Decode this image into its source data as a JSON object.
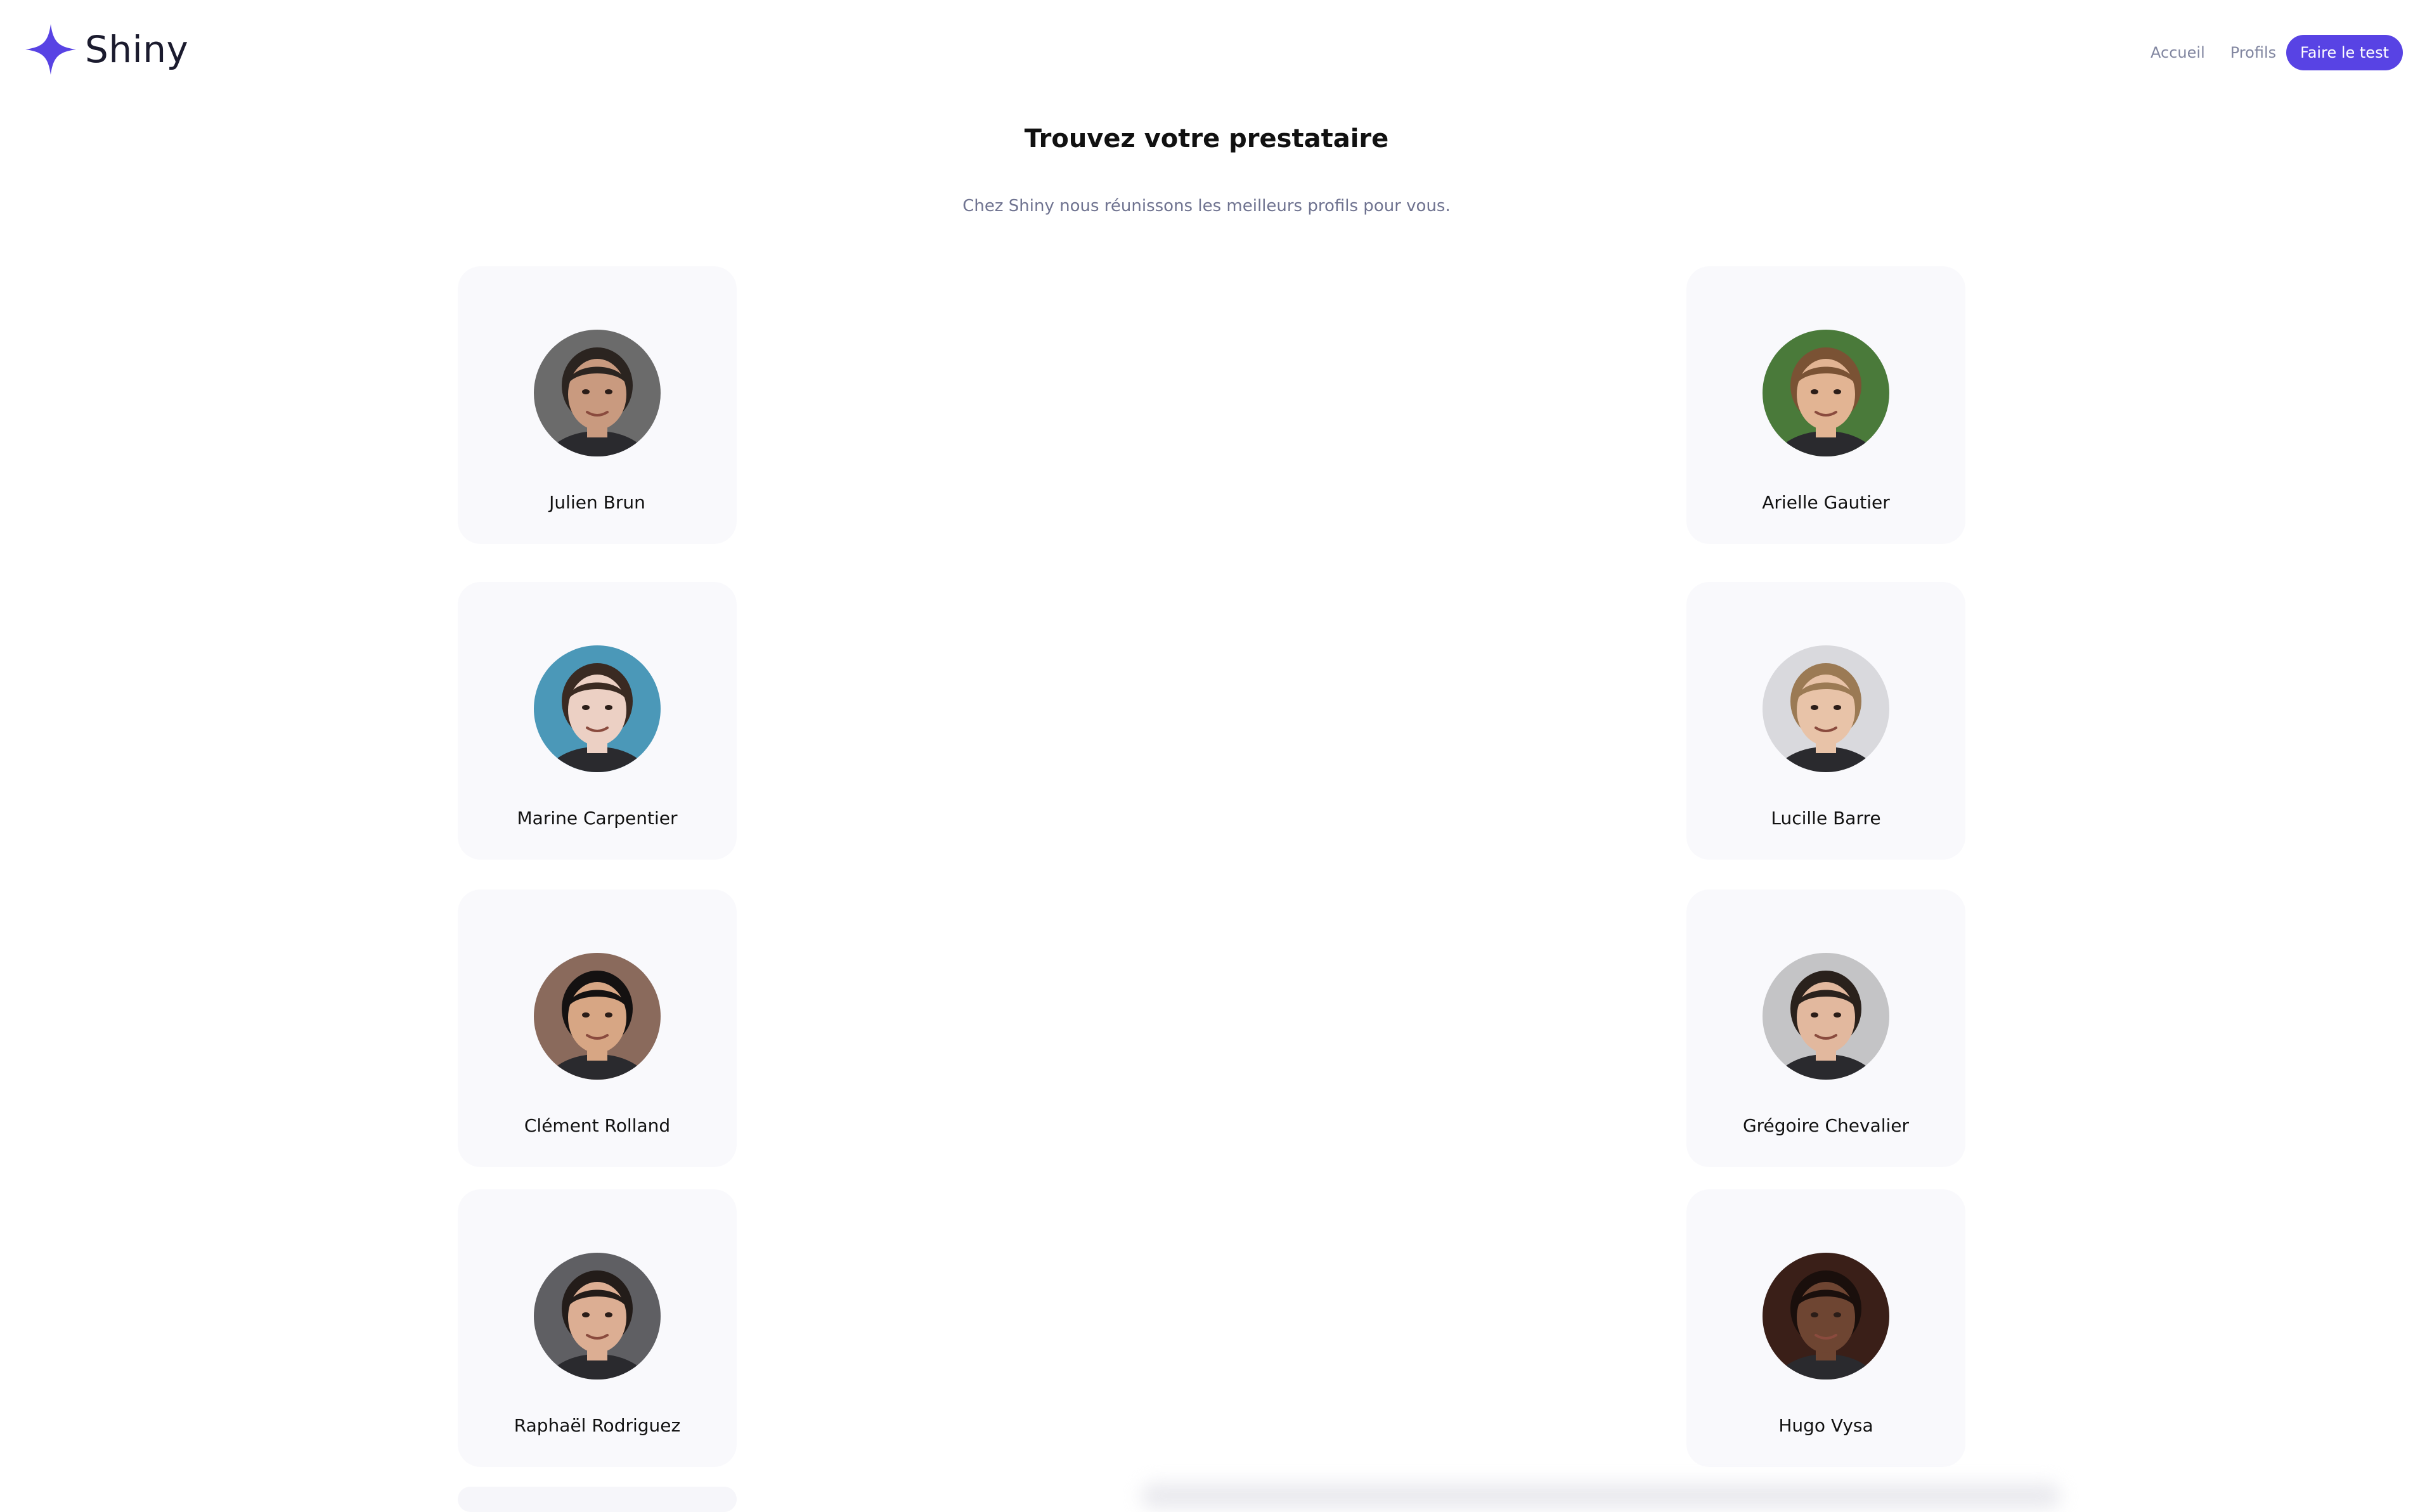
{
  "header": {
    "logo_text": "Shiny",
    "brand_color": "#5843e4",
    "nav": {
      "home_label": "Accueil",
      "profiles_label": "Profils",
      "test_label": "Faire le test"
    }
  },
  "main": {
    "title": "Trouvez votre prestataire",
    "subtitle": "Chez Shiny nous réunissons les meilleurs profils pour vous."
  },
  "profiles": [
    {
      "name": "Julien Brun",
      "avatar": "avatar-man-beard-gray-bg",
      "bg": "#6b6b6b",
      "skin": "#c99a7f",
      "hair": "#2b2420"
    },
    {
      "name": "Arielle Gautier",
      "avatar": "avatar-woman-green-bg",
      "bg": "#4a7a3a",
      "skin": "#e2b493",
      "hair": "#7a5234"
    },
    {
      "name": "Marine Carpentier",
      "avatar": "avatar-woman-blue-bg",
      "bg": "#4b98b8",
      "skin": "#ecd0c4",
      "hair": "#3a2a22"
    },
    {
      "name": "Lucille Barre",
      "avatar": "avatar-woman-light-bg",
      "bg": "#d9d9dd",
      "skin": "#e8c3a8",
      "hair": "#9b7a54"
    },
    {
      "name": "Clément Rolland",
      "avatar": "avatar-man-brown-bg",
      "bg": "#8a6a5c",
      "skin": "#d7a684",
      "hair": "#141111"
    },
    {
      "name": "Grégoire Chevalier",
      "avatar": "avatar-man-gray-bg",
      "bg": "#c4c4c6",
      "skin": "#e2b89e",
      "hair": "#2a211c"
    },
    {
      "name": "Raphaël Rodriguez",
      "avatar": "avatar-man-dark-gray-bg",
      "bg": "#5f5f63",
      "skin": "#dcae93",
      "hair": "#231c19"
    },
    {
      "name": "Hugo Vysa",
      "avatar": "avatar-man-dark-bg",
      "bg": "#3a1f18",
      "skin": "#6e4532",
      "hair": "#1a0f0c"
    }
  ]
}
